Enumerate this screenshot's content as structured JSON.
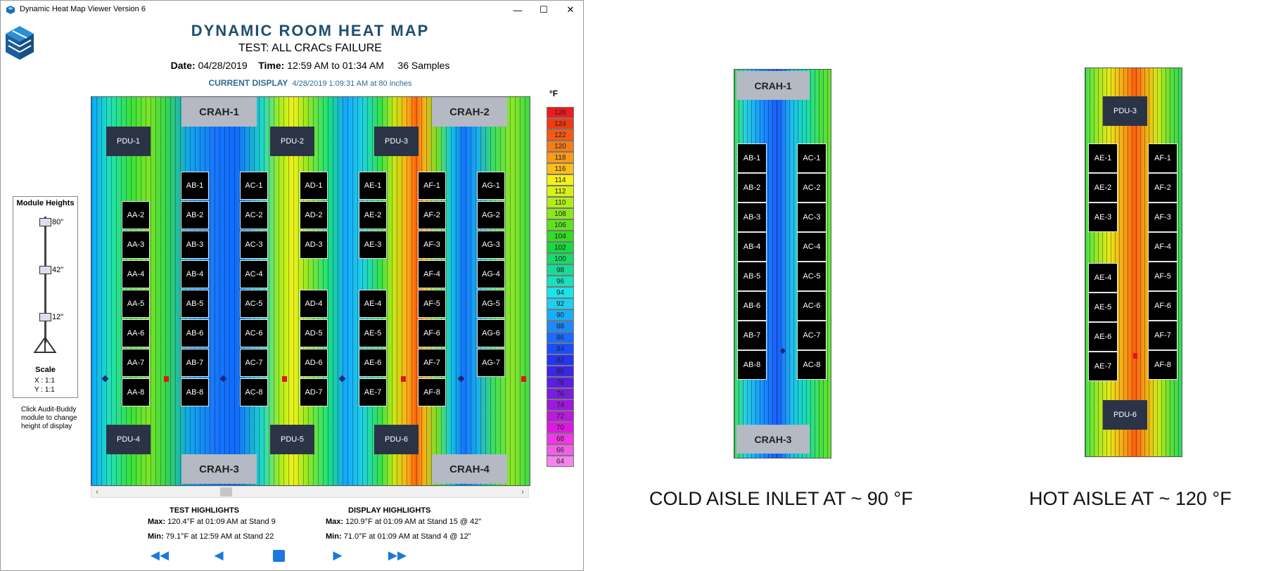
{
  "window": {
    "title": "Dynamic Heat Map Viewer Version 6",
    "minimize": "—",
    "maximize": "☐",
    "close": "✕"
  },
  "header": {
    "main_title": "DYNAMIC ROOM HEAT MAP",
    "test_title": "TEST: ALL CRACs FAILURE",
    "date_label": "Date:",
    "date_value": "04/28/2019",
    "time_label": "Time:",
    "time_value": "12:59 AM to 01:34 AM",
    "samples": "36 Samples",
    "current_display_label": "CURRENT DISPLAY",
    "current_display_value": "4/28/2019 1:09:31 AM at 80 inches"
  },
  "heatmap": {
    "crahs": [
      "CRAH-1",
      "CRAH-2",
      "CRAH-3",
      "CRAH-4"
    ],
    "pdus": [
      "PDU-1",
      "PDU-2",
      "PDU-3",
      "PDU-4",
      "PDU-5",
      "PDU-6"
    ],
    "rows": {
      "AA": [
        "AA-2",
        "AA-3",
        "AA-4",
        "AA-5",
        "AA-6",
        "AA-7",
        "AA-8"
      ],
      "AB": [
        "AB-1",
        "AB-2",
        "AB-3",
        "AB-4",
        "AB-5",
        "AB-6",
        "AB-7",
        "AB-8"
      ],
      "AC": [
        "AC-1",
        "AC-2",
        "AC-3",
        "AC-4",
        "AC-5",
        "AC-6",
        "AC-7",
        "AC-8"
      ],
      "AD_top": [
        "AD-1",
        "AD-2",
        "AD-3"
      ],
      "AD_bottom": [
        "AD-4",
        "AD-5",
        "AD-6",
        "AD-7"
      ],
      "AE_top": [
        "AE-1",
        "AE-2",
        "AE-3"
      ],
      "AE_bottom": [
        "AE-4",
        "AE-5",
        "AE-6",
        "AE-7"
      ],
      "AF": [
        "AF-1",
        "AF-2",
        "AF-3",
        "AF-4",
        "AF-5",
        "AF-6",
        "AF-7",
        "AF-8"
      ],
      "AG": [
        "AG-1",
        "AG-2",
        "AG-3",
        "AG-4",
        "AG-5",
        "AG-6",
        "AG-7"
      ]
    }
  },
  "legend": {
    "unit": "°F",
    "entries": [
      {
        "label": "126",
        "color": "#ee1c1c"
      },
      {
        "label": "124",
        "color": "#f23a12"
      },
      {
        "label": "122",
        "color": "#f45a14"
      },
      {
        "label": "120",
        "color": "#f77b17"
      },
      {
        "label": "118",
        "color": "#f99b18"
      },
      {
        "label": "116",
        "color": "#fbbd1c"
      },
      {
        "label": "114",
        "color": "#f6f01a"
      },
      {
        "label": "112",
        "color": "#d7ef1a"
      },
      {
        "label": "110",
        "color": "#b2ec1b"
      },
      {
        "label": "108",
        "color": "#8ce71c"
      },
      {
        "label": "106",
        "color": "#5fe21f"
      },
      {
        "label": "104",
        "color": "#34dc25"
      },
      {
        "label": "102",
        "color": "#1ad83e"
      },
      {
        "label": "100",
        "color": "#18d96a"
      },
      {
        "label": "98",
        "color": "#18dc95"
      },
      {
        "label": "96",
        "color": "#19e0c0"
      },
      {
        "label": "94",
        "color": "#1be4e6"
      },
      {
        "label": "92",
        "color": "#1bd0f4"
      },
      {
        "label": "90",
        "color": "#1aaef8"
      },
      {
        "label": "88",
        "color": "#198bfa"
      },
      {
        "label": "86",
        "color": "#1a6cfc"
      },
      {
        "label": "84",
        "color": "#1a4ef8"
      },
      {
        "label": "82",
        "color": "#2534ee"
      },
      {
        "label": "80",
        "color": "#3a26e6"
      },
      {
        "label": "78",
        "color": "#5a20e0"
      },
      {
        "label": "76",
        "color": "#7a1cdc"
      },
      {
        "label": "74",
        "color": "#9a1adb"
      },
      {
        "label": "72",
        "color": "#bb1add"
      },
      {
        "label": "70",
        "color": "#db1ae0"
      },
      {
        "label": "68",
        "color": "#ef38e6"
      },
      {
        "label": "66",
        "color": "#f35ee8"
      },
      {
        "label": "64",
        "color": "#f783ee"
      }
    ]
  },
  "module_heights": {
    "title": "Module Heights",
    "levels": [
      "80\"",
      "42\"",
      "12\""
    ],
    "scale_label": "Scale",
    "scale_x": "X : 1:1",
    "scale_y": "Y : 1:1",
    "note": "Click Audit-Buddy module to change height of display"
  },
  "highlights": {
    "test": {
      "title": "TEST HIGHLIGHTS",
      "max_label": "Max:",
      "max_value": "120.4°F at 01:09 AM at Stand 9",
      "min_label": "Min:",
      "min_value": "79.1°F at 12:59 AM at Stand 22"
    },
    "display": {
      "title": "DISPLAY HIGHLIGHTS",
      "max_label": "Max:",
      "max_value": "120.9°F at 01:09 AM at Stand 15 @ 42\"",
      "min_label": "Min:",
      "min_value": "71.0°F at 01:09 AM at Stand 4 @ 12\""
    }
  },
  "controls": {
    "rewind": "◀◀",
    "prev": "◀",
    "next": "▶",
    "forward": "▶▶"
  },
  "cold_aisle": {
    "crah_top": "CRAH-1",
    "crah_bottom": "CRAH-3",
    "left": [
      "AB-1",
      "AB-2",
      "AB-3",
      "AB-4",
      "AB-5",
      "AB-6",
      "AB-7",
      "AB-8"
    ],
    "right": [
      "AC-1",
      "AC-2",
      "AC-3",
      "AC-4",
      "AC-5",
      "AC-6",
      "AC-7",
      "AC-8"
    ],
    "caption": "COLD AISLE INLET AT  ~ 90 °F"
  },
  "hot_aisle": {
    "pdu_top": "PDU-3",
    "pdu_bottom": "PDU-6",
    "left_top": [
      "AE-1",
      "AE-2",
      "AE-3"
    ],
    "left_bottom": [
      "AE-4",
      "AE-5",
      "AE-6",
      "AE-7"
    ],
    "right": [
      "AF-1",
      "AF-2",
      "AF-3",
      "AF-4",
      "AF-5",
      "AF-6",
      "AF-7",
      "AF-8"
    ],
    "caption": "HOT AISLE AT ~ 120 °F"
  }
}
